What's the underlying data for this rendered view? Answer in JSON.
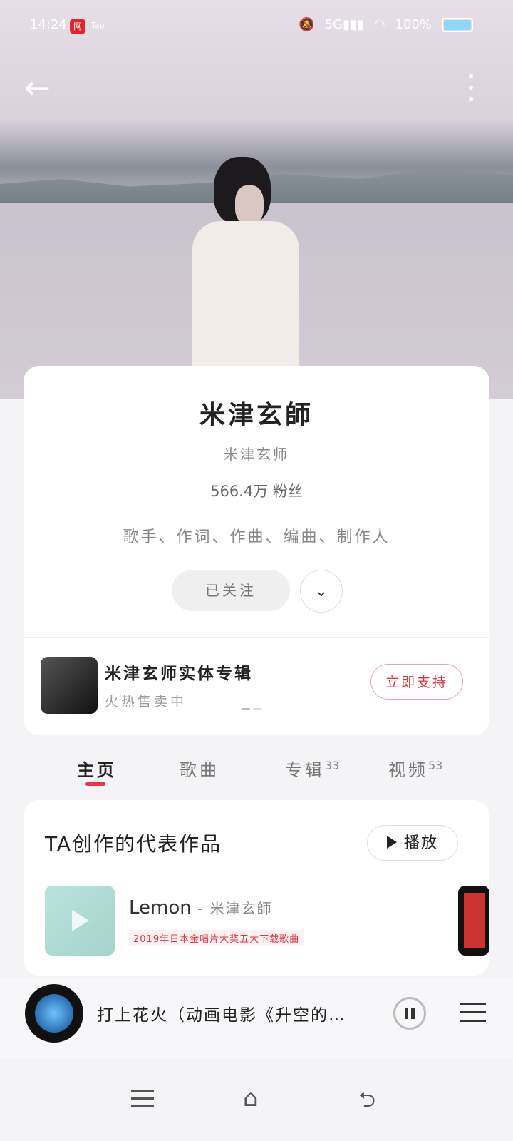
{
  "status_bar": {
    "time": "14:24",
    "app_badge": "网",
    "tap": "Tap",
    "battery": "100%"
  },
  "header": {
    "back_label": "←"
  },
  "profile": {
    "name": "米津玄師",
    "alias": "米津玄师",
    "fans": "566.4万 粉丝",
    "roles": "歌手、作词、作曲、编曲、制作人",
    "follow_label": "已关注",
    "expand_icon": "⌄"
  },
  "album_promo": {
    "title": "米津玄师实体专辑",
    "subtitle": "火热售卖中",
    "support_label": "立即支持"
  },
  "tabs": [
    {
      "label": "主页",
      "count": ""
    },
    {
      "label": "歌曲",
      "count": ""
    },
    {
      "label": "专辑",
      "count": "33"
    },
    {
      "label": "视频",
      "count": "53"
    }
  ],
  "works": {
    "title": "TA创作的代表作品",
    "play_label": "播放",
    "song": {
      "title": "Lemon",
      "artist": " - 米津玄師",
      "tag": "2019年日本金唱片大奖五大下载歌曲"
    }
  },
  "player": {
    "title": "打上花火（动画电影《升空的…"
  },
  "nav": {
    "home_icon": "⌂",
    "back_icon": "⮌"
  }
}
